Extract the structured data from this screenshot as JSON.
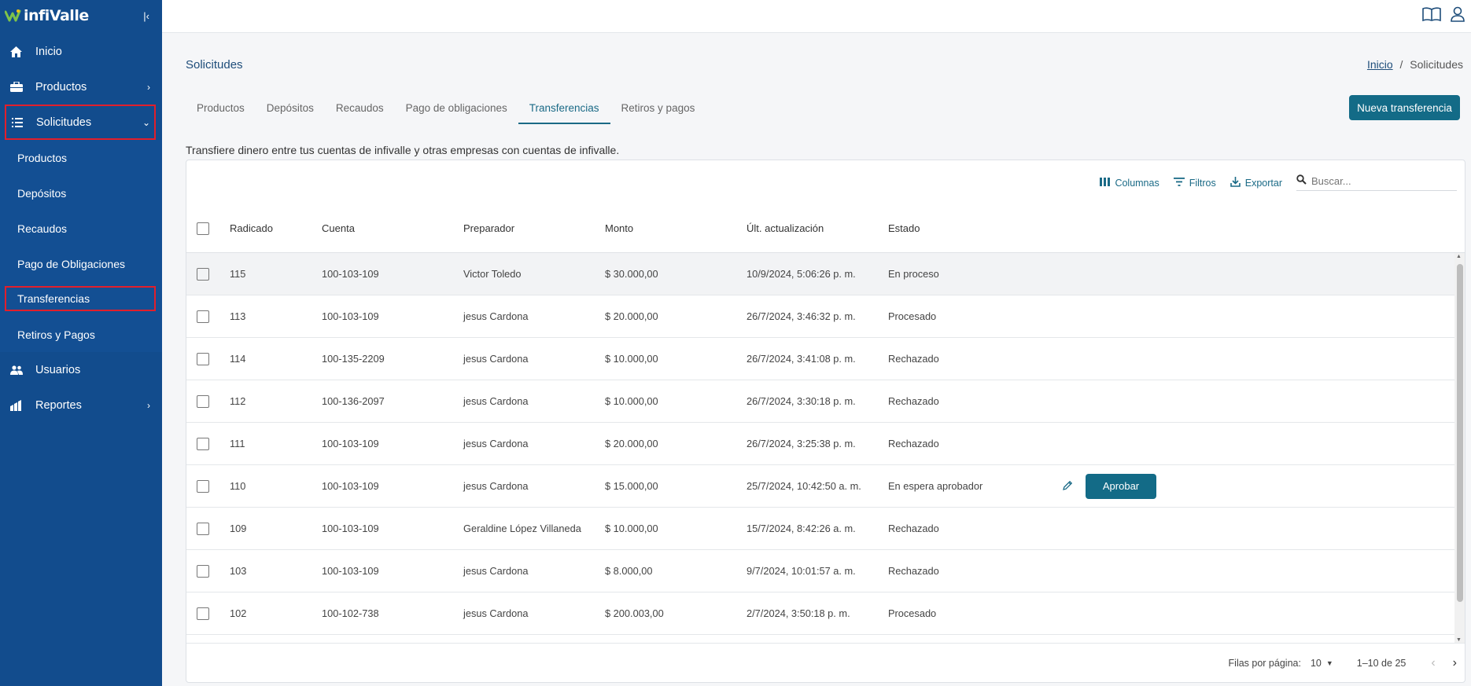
{
  "app": {
    "logo": "infiValle",
    "collapse_icon": "collapse-left-icon"
  },
  "sidebar": {
    "items": [
      {
        "label": "Inicio",
        "icon": "home-icon"
      },
      {
        "label": "Productos",
        "icon": "briefcase-icon"
      },
      {
        "label": "Solicitudes",
        "icon": "list-icon"
      },
      {
        "label": "Usuarios",
        "icon": "users-icon"
      },
      {
        "label": "Reportes",
        "icon": "chart-icon"
      }
    ],
    "sub_items": [
      "Productos",
      "Depósitos",
      "Recaudos",
      "Pago de Obligaciones",
      "Transferencias",
      "Retiros y Pagos"
    ]
  },
  "header": {
    "icons": [
      "book-icon",
      "user-icon"
    ]
  },
  "page": {
    "title": "Solicitudes",
    "breadcrumb": {
      "home": "Inicio",
      "separator": "/",
      "current": "Solicitudes"
    },
    "tabs": [
      "Productos",
      "Depósitos",
      "Recaudos",
      "Pago de obligaciones",
      "Transferencias",
      "Retiros y pagos"
    ],
    "active_tab": "Transferencias",
    "new_button": "Nueva transferencia",
    "description": "Transfiere dinero entre tus cuentas de infivalle y otras empresas con cuentas de infivalle."
  },
  "table": {
    "toolbar": {
      "columns": "Columnas",
      "filters": "Filtros",
      "export": "Exportar",
      "search_placeholder": "Buscar..."
    },
    "columns": [
      "Radicado",
      "Cuenta",
      "Preparador",
      "Monto",
      "Últ. actualización",
      "Estado"
    ],
    "rows": [
      {
        "radicado": "115",
        "cuenta": "100-103-109",
        "preparador": "Victor Toledo",
        "monto": "$ 30.000,00",
        "actualizacion": "10/9/2024, 5:06:26 p. m.",
        "estado": "En proceso"
      },
      {
        "radicado": "113",
        "cuenta": "100-103-109",
        "preparador": "jesus Cardona",
        "monto": "$ 20.000,00",
        "actualizacion": "26/7/2024, 3:46:32 p. m.",
        "estado": "Procesado"
      },
      {
        "radicado": "114",
        "cuenta": "100-135-2209",
        "preparador": "jesus Cardona",
        "monto": "$ 10.000,00",
        "actualizacion": "26/7/2024, 3:41:08 p. m.",
        "estado": "Rechazado"
      },
      {
        "radicado": "112",
        "cuenta": "100-136-2097",
        "preparador": "jesus Cardona",
        "monto": "$ 10.000,00",
        "actualizacion": "26/7/2024, 3:30:18 p. m.",
        "estado": "Rechazado"
      },
      {
        "radicado": "111",
        "cuenta": "100-103-109",
        "preparador": "jesus Cardona",
        "monto": "$ 20.000,00",
        "actualizacion": "26/7/2024, 3:25:38 p. m.",
        "estado": "Rechazado"
      },
      {
        "radicado": "110",
        "cuenta": "100-103-109",
        "preparador": "jesus Cardona",
        "monto": "$ 15.000,00",
        "actualizacion": "25/7/2024, 10:42:50 a. m.",
        "estado": "En espera aprobador",
        "action": "Aprobar"
      },
      {
        "radicado": "109",
        "cuenta": "100-103-109",
        "preparador": "Geraldine López Villaneda",
        "monto": "$ 10.000,00",
        "actualizacion": "15/7/2024, 8:42:26 a. m.",
        "estado": "Rechazado"
      },
      {
        "radicado": "103",
        "cuenta": "100-103-109",
        "preparador": "jesus Cardona",
        "monto": "$ 8.000,00",
        "actualizacion": "9/7/2024, 10:01:57 a. m.",
        "estado": "Rechazado"
      },
      {
        "radicado": "102",
        "cuenta": "100-102-738",
        "preparador": "jesus Cardona",
        "monto": "$ 200.003,00",
        "actualizacion": "2/7/2024, 3:50:18 p. m.",
        "estado": "Procesado"
      }
    ],
    "footer": {
      "rows_per_page_label": "Filas por página:",
      "rows_per_page": "10",
      "range": "1–10 de 25"
    }
  },
  "colors": {
    "sidebar": "#124c8d",
    "accent": "#136b87",
    "highlight": "#e21f2b"
  }
}
